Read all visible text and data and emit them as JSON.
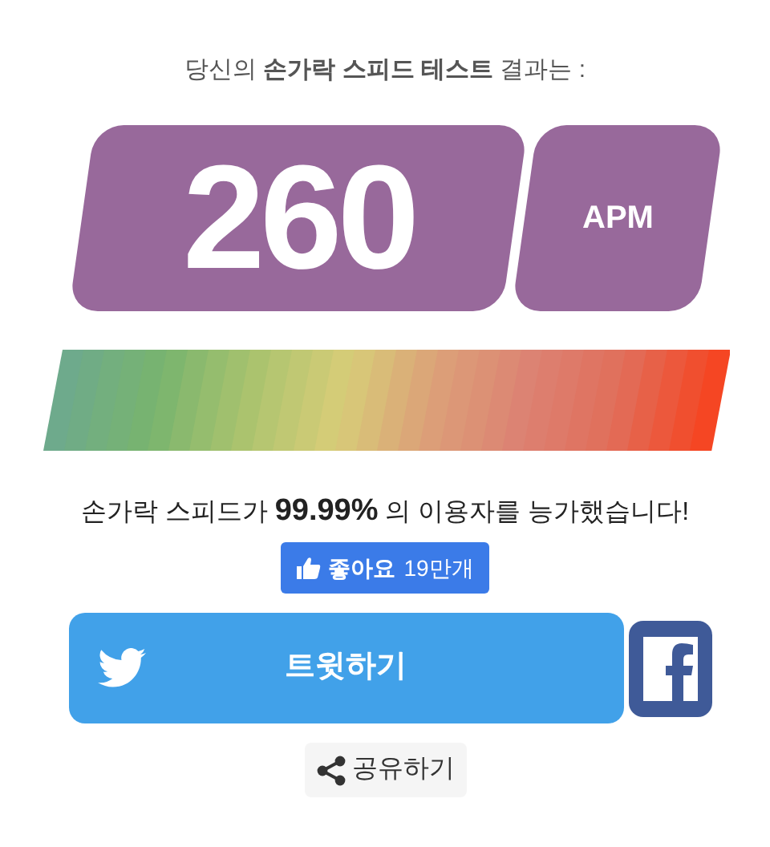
{
  "headline": "당신의 **손가락 스피드 테스트** 결과는 :",
  "score": {
    "value": "260",
    "unit": "APM"
  },
  "result_sentence": "손가락 스피드가  **99.99%** 의 이용자를 능가했습니다!",
  "like_button": {
    "label": "좋아요",
    "count": "19만개"
  },
  "tweet_button": {
    "label": "트윗하기"
  },
  "share_button": {
    "label": "공유하기"
  }
}
